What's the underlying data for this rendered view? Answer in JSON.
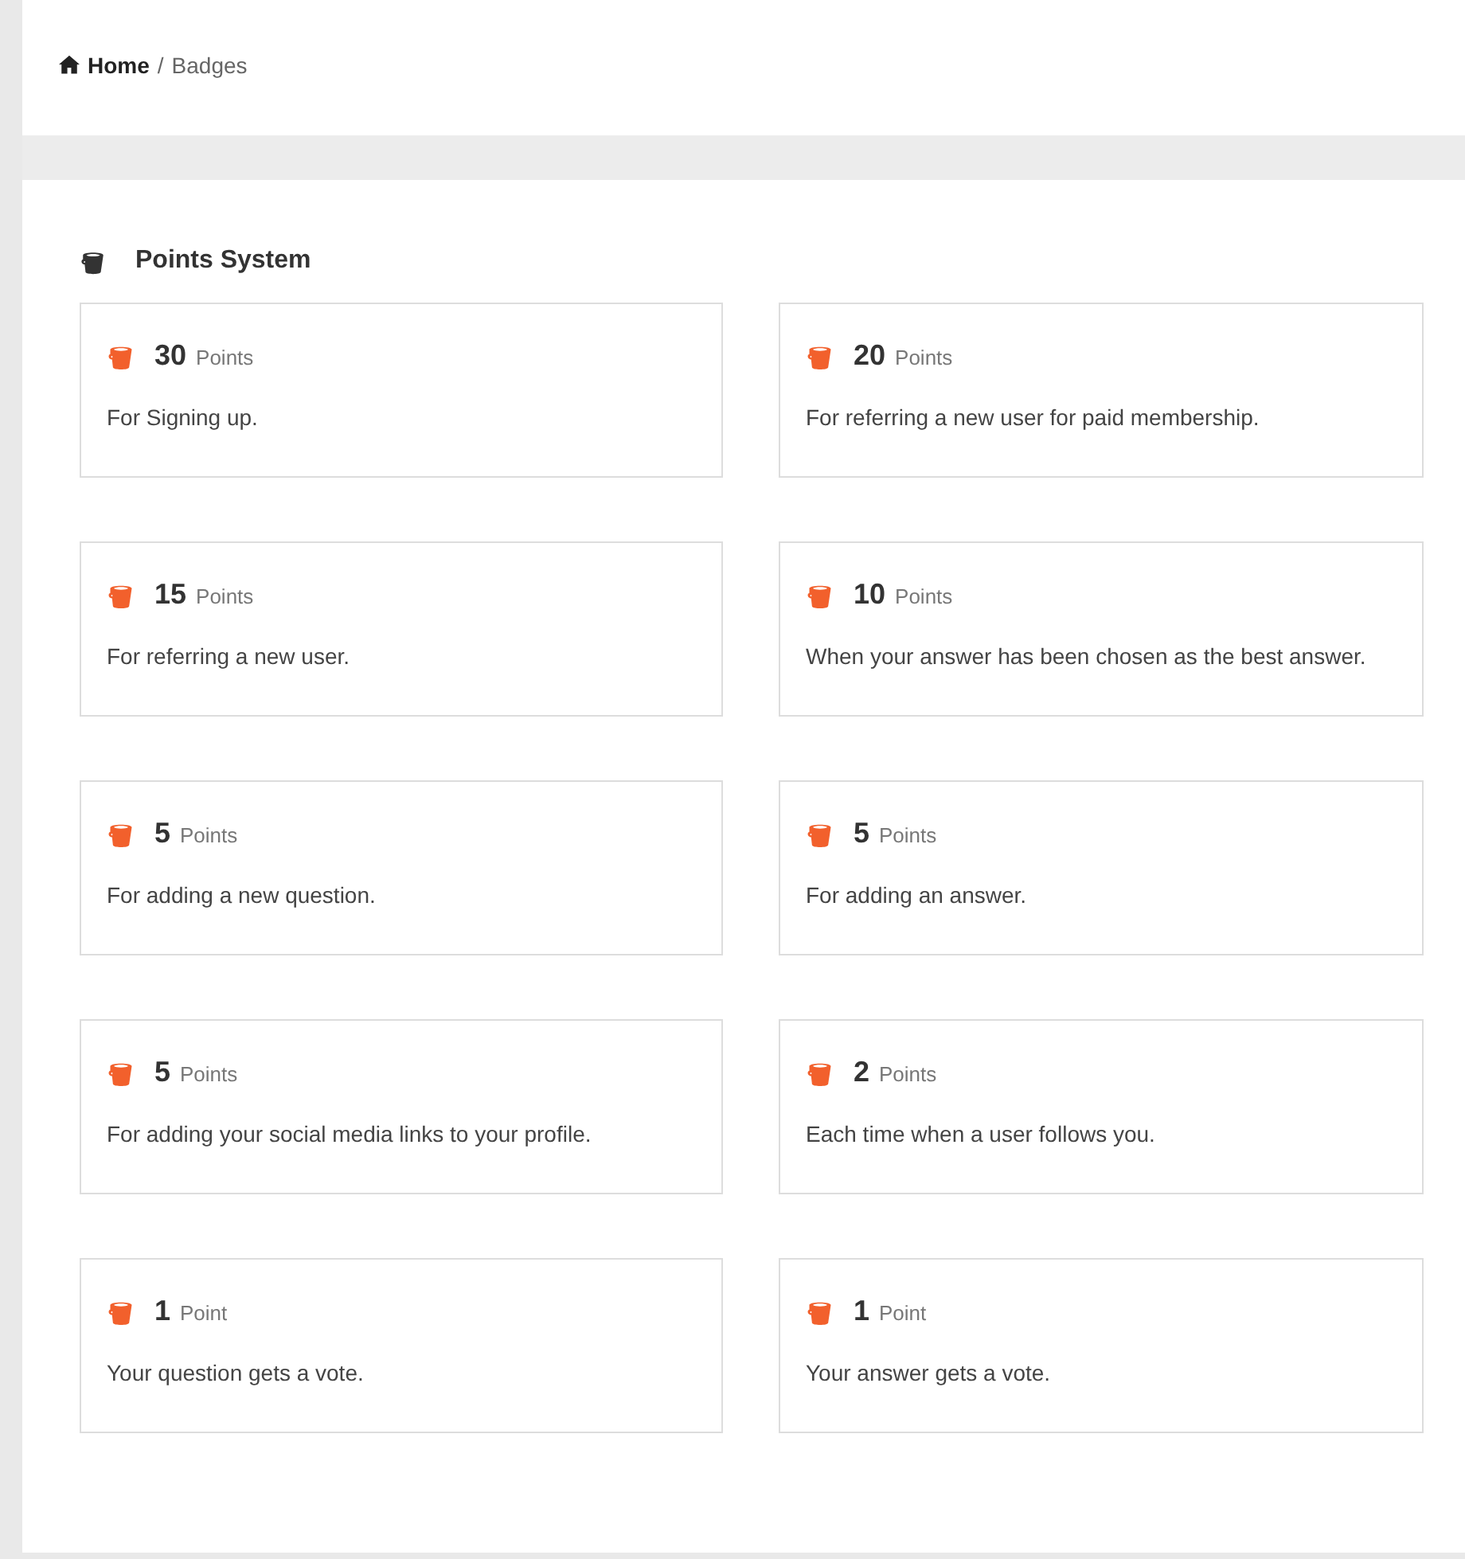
{
  "breadcrumb": {
    "home": "Home",
    "separator": "/",
    "current": "Badges"
  },
  "section": {
    "title": "Points System"
  },
  "cards": [
    {
      "points": "30",
      "unit": "Points",
      "description": "For Signing up."
    },
    {
      "points": "20",
      "unit": "Points",
      "description": "For referring a new user for paid membership."
    },
    {
      "points": "15",
      "unit": "Points",
      "description": "For referring a new user."
    },
    {
      "points": "10",
      "unit": "Points",
      "description": "When your answer has been chosen as the best answer."
    },
    {
      "points": "5",
      "unit": "Points",
      "description": "For adding a new question."
    },
    {
      "points": "5",
      "unit": "Points",
      "description": "For adding an answer."
    },
    {
      "points": "5",
      "unit": "Points",
      "description": "For adding your social media links to your profile."
    },
    {
      "points": "2",
      "unit": "Points",
      "description": "Each time when a user follows you."
    },
    {
      "points": "1",
      "unit": "Point",
      "description": "Your question gets a vote."
    },
    {
      "points": "1",
      "unit": "Point",
      "description": "Your answer gets a vote."
    }
  ]
}
